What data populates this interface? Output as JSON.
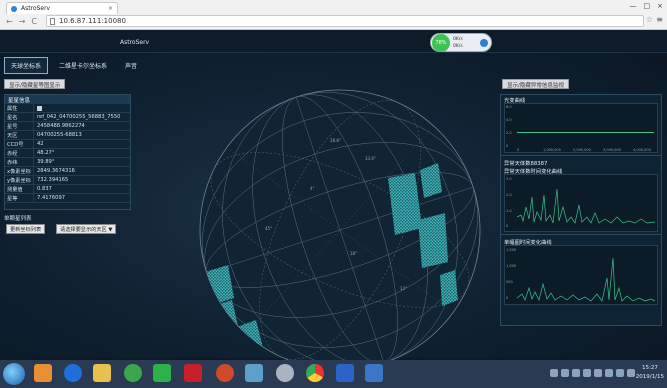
{
  "browser": {
    "tab_title": "AstroServ",
    "url": "10.6.87.111:10080",
    "tab_close": "×",
    "nav": [
      "←",
      "→",
      "C"
    ],
    "star": "☆",
    "menu": "≡",
    "win": [
      "—",
      "□",
      "×"
    ]
  },
  "app": {
    "title": "AstroServ",
    "gauge": {
      "value": "78%",
      "stat1": "0K/s",
      "stat2": "0K/s"
    },
    "tabs": [
      "天球坐标系",
      "二维星卡尔坐标系",
      "声音"
    ],
    "left_button": "显示/隐藏星等图显示",
    "right_button": "显示/隐藏异常信息监视"
  },
  "star_info": {
    "header": "星星信息",
    "rows": [
      {
        "k": "属性",
        "v": ""
      },
      {
        "k": "星名",
        "v": "ref_042_04700255_56883_7550"
      },
      {
        "k": "星号",
        "v": "2458488.9862274"
      },
      {
        "k": "天区",
        "v": "04700255-68813"
      },
      {
        "k": "CCD号",
        "v": "42"
      },
      {
        "k": "赤经",
        "v": "48.27°"
      },
      {
        "k": "赤纬",
        "v": "39.89°"
      },
      {
        "k": "x像素坐标",
        "v": "2849.3674316"
      },
      {
        "k": "y像素坐标",
        "v": "732.394165"
      },
      {
        "k": "测量值",
        "v": "0.837"
      },
      {
        "k": "星等",
        "v": "7.4176097"
      }
    ]
  },
  "list_section": {
    "title": "单颗星列表",
    "button": "更新坐标列表",
    "select": "请选择要显示的天区 ▼"
  },
  "charts": {
    "c1_title": "光变曲线",
    "c1_y": [
      "6.0",
      "4.0",
      "2.0",
      "0"
    ],
    "c1_x": [
      "0",
      "1,000,000",
      "2,000,000",
      "3,000,000",
      "4,000,000"
    ],
    "c2_label": "异常天体数88387",
    "c2_title": "异常天体数时间变化曲线",
    "c2_y": [
      "3.0",
      "2.0",
      "1.0",
      "0"
    ],
    "c3_title": "单幅图时间变化曲线",
    "c3_y": [
      "1,500",
      "1,000",
      "500",
      "0"
    ]
  },
  "colors": {
    "star_points": "#3fd4d4",
    "series": "#3cc48a",
    "accent": "#2a7fd6"
  },
  "taskbar": {
    "time": "15:27",
    "date": "2019/1/15"
  }
}
